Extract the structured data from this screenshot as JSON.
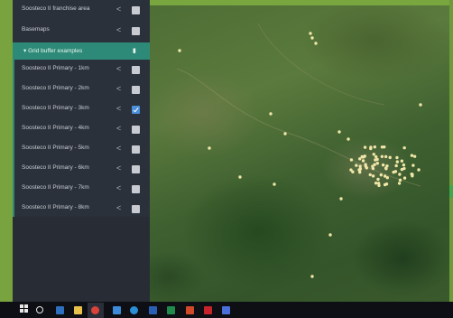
{
  "sidebar": {
    "top_rows": [
      {
        "label": "Soosteco II franchise area",
        "checked": false
      },
      {
        "label": "Basemaps",
        "checked": false
      }
    ],
    "group": {
      "label": "▾ Grid buffer examples"
    },
    "group_rows": [
      {
        "label": "Soosteco II Primary - 1km",
        "checked": false
      },
      {
        "label": "Soosteco II Primary - 2km",
        "checked": false
      },
      {
        "label": "Soosteco II Primary - 3km",
        "checked": true
      },
      {
        "label": "Soosteco II Primary - 4km",
        "checked": false
      },
      {
        "label": "Soosteco II Primary - 5km",
        "checked": false
      },
      {
        "label": "Soosteco II Primary - 6km",
        "checked": false
      },
      {
        "label": "Soosteco II Primary - 7km",
        "checked": false
      },
      {
        "label": "Soosteco II Primary - 8km",
        "checked": false
      }
    ],
    "chevron": "<",
    "lock_icon": "lock-icon"
  },
  "colors": {
    "sidebar_bg": "#2b313b",
    "group_accent": "#2e8a78",
    "checkbox_on": "#4a8fd8",
    "marker": "#f0e6a8"
  },
  "taskbar": {
    "icons": [
      "windows-start-icon",
      "search-icon",
      "taskview-icon",
      "file-explorer-icon",
      "chrome-icon",
      "app-icon",
      "edge-icon",
      "word-icon",
      "excel-icon",
      "powerpoint-icon",
      "acrobat-icon",
      "teams-icon"
    ]
  }
}
